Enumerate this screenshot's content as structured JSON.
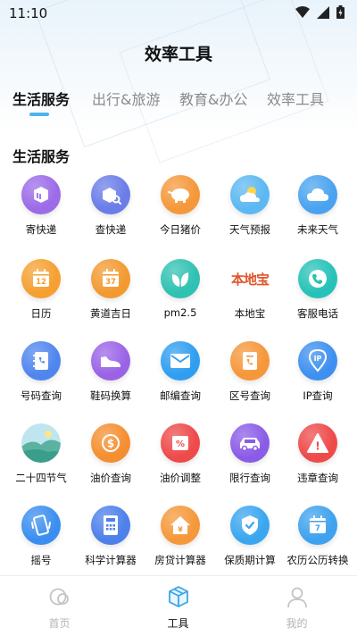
{
  "status": {
    "time": "11:10"
  },
  "title": "效率工具",
  "tabs": [
    {
      "label": "生活服务"
    },
    {
      "label": "出行&旅游"
    },
    {
      "label": "教育&办公"
    },
    {
      "label": "效率工具"
    }
  ],
  "section_title": "生活服务",
  "tools": [
    {
      "label": "寄快递",
      "icon": "package-send-icon",
      "color": "#9b6be8"
    },
    {
      "label": "查快递",
      "icon": "package-search-icon",
      "color": "#6a7de8"
    },
    {
      "label": "今日猪价",
      "icon": "pig-icon",
      "color": "#f5983a"
    },
    {
      "label": "天气预报",
      "icon": "weather-sun-cloud-icon",
      "color": "#5cb8f2"
    },
    {
      "label": "未来天气",
      "icon": "cloud-icon",
      "color": "#4aa3f0"
    },
    {
      "label": "日历",
      "icon": "calendar-icon",
      "color": "#f5a030",
      "text": "12"
    },
    {
      "label": "黄道吉日",
      "icon": "calendar-lucky-icon",
      "color": "#f29a30",
      "text": "37"
    },
    {
      "label": "pm2.5",
      "icon": "leaf-icon",
      "color": "#2fc1b2"
    },
    {
      "label": "本地宝",
      "icon": "bendibao-logo",
      "color": "#e0562b",
      "text": "本地宝"
    },
    {
      "label": "客服电话",
      "icon": "phone-icon",
      "color": "#26c2b8"
    },
    {
      "label": "号码查询",
      "icon": "phone-book-icon",
      "color": "#4f86ee"
    },
    {
      "label": "鞋码换算",
      "icon": "shoe-icon",
      "color": "#9a63e6"
    },
    {
      "label": "邮编查询",
      "icon": "envelope-icon",
      "color": "#2f9ef0"
    },
    {
      "label": "区号查询",
      "icon": "area-code-icon",
      "color": "#f5973a"
    },
    {
      "label": "IP查询",
      "icon": "ip-location-icon",
      "color": "#3d90f0",
      "text": "IP"
    },
    {
      "label": "二十四节气",
      "icon": "landscape-icon",
      "color": "#58b9c9"
    },
    {
      "label": "油价查询",
      "icon": "dollar-icon",
      "color": "#f58e30",
      "text": "$"
    },
    {
      "label": "油价调整",
      "icon": "percent-tag-icon",
      "color": "#ee4a4a",
      "text": "%"
    },
    {
      "label": "限行查询",
      "icon": "car-icon",
      "color": "#8a5ce6"
    },
    {
      "label": "违章查询",
      "icon": "warning-icon",
      "color": "#ee4a4a",
      "text": "!"
    },
    {
      "label": "摇号",
      "icon": "phone-shake-icon",
      "color": "#3a8ef0"
    },
    {
      "label": "科学计算器",
      "icon": "calculator-icon",
      "color": "#4d80ea"
    },
    {
      "label": "房贷计算器",
      "icon": "house-loan-icon",
      "color": "#f5983a"
    },
    {
      "label": "保质期计算",
      "icon": "shield-check-icon",
      "color": "#3aa6f0"
    },
    {
      "label": "农历公历转换",
      "icon": "calendar-convert-icon",
      "color": "#3ea2ee",
      "text": "7"
    }
  ],
  "nav": [
    {
      "label": "首页",
      "icon": "home-icon"
    },
    {
      "label": "工具",
      "icon": "toolbox-icon"
    },
    {
      "label": "我的",
      "icon": "user-icon"
    }
  ],
  "colors": {
    "accent": "#4fb3ea",
    "inactive": "#8a8a8a"
  }
}
